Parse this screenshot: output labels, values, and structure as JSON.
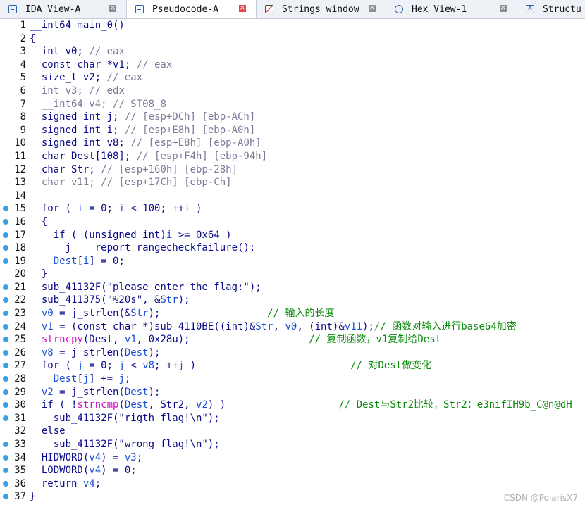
{
  "tabs": [
    {
      "label": "IDA View-A",
      "icon": "document-icon",
      "active": false
    },
    {
      "label": "Pseudocode-A",
      "icon": "document-icon",
      "active": true
    },
    {
      "label": "Strings window",
      "icon": "strings-icon",
      "active": false
    },
    {
      "label": "Hex View-1",
      "icon": "hex-icon",
      "active": false
    },
    {
      "label": "Structu",
      "icon": "structure-icon",
      "active": false
    }
  ],
  "tab_close_glyph": "×",
  "code_lines": [
    {
      "n": "1",
      "dot": false,
      "segs": [
        {
          "t": "__int64 main_0()",
          "c": "kw"
        }
      ]
    },
    {
      "n": "2",
      "dot": false,
      "segs": [
        {
          "t": "{",
          "c": "kw"
        }
      ]
    },
    {
      "n": "3",
      "dot": false,
      "segs": [
        {
          "t": "  int v0; ",
          "c": "kw"
        },
        {
          "t": "// eax",
          "c": "gry"
        }
      ]
    },
    {
      "n": "4",
      "dot": false,
      "segs": [
        {
          "t": "  const char *v1; ",
          "c": "kw"
        },
        {
          "t": "// eax",
          "c": "gry"
        }
      ]
    },
    {
      "n": "5",
      "dot": false,
      "segs": [
        {
          "t": "  size_t v2; ",
          "c": "kw"
        },
        {
          "t": "// eax",
          "c": "gry"
        }
      ]
    },
    {
      "n": "6",
      "dot": false,
      "segs": [
        {
          "t": "  int v3; ",
          "c": "gry"
        },
        {
          "t": "// edx",
          "c": "gry"
        }
      ]
    },
    {
      "n": "7",
      "dot": false,
      "segs": [
        {
          "t": "  __int64 v4; ",
          "c": "gry"
        },
        {
          "t": "// ST08_8",
          "c": "gry"
        }
      ]
    },
    {
      "n": "8",
      "dot": false,
      "segs": [
        {
          "t": "  signed int j; ",
          "c": "kw"
        },
        {
          "t": "// [esp+DCh] [ebp-ACh]",
          "c": "gry"
        }
      ]
    },
    {
      "n": "9",
      "dot": false,
      "segs": [
        {
          "t": "  signed int i; ",
          "c": "kw"
        },
        {
          "t": "// [esp+E8h] [ebp-A0h]",
          "c": "gry"
        }
      ]
    },
    {
      "n": "10",
      "dot": false,
      "segs": [
        {
          "t": "  signed int v8; ",
          "c": "kw"
        },
        {
          "t": "// [esp+E8h] [ebp-A0h]",
          "c": "gry"
        }
      ]
    },
    {
      "n": "11",
      "dot": false,
      "segs": [
        {
          "t": "  char Dest[108]; ",
          "c": "kw"
        },
        {
          "t": "// [esp+F4h] [ebp-94h]",
          "c": "gry"
        }
      ]
    },
    {
      "n": "12",
      "dot": false,
      "segs": [
        {
          "t": "  char Str; ",
          "c": "kw"
        },
        {
          "t": "// [esp+160h] [ebp-28h]",
          "c": "gry"
        }
      ]
    },
    {
      "n": "13",
      "dot": false,
      "segs": [
        {
          "t": "  char v11; ",
          "c": "gry"
        },
        {
          "t": "// [esp+17Ch] [ebp-Ch]",
          "c": "gry"
        }
      ]
    },
    {
      "n": "14",
      "dot": false,
      "segs": [
        {
          "t": "",
          "c": "kw"
        }
      ]
    },
    {
      "n": "15",
      "dot": true,
      "segs": [
        {
          "t": "  for ( ",
          "c": "kw"
        },
        {
          "t": "i",
          "c": "var"
        },
        {
          "t": " = 0; ",
          "c": "kw"
        },
        {
          "t": "i",
          "c": "var"
        },
        {
          "t": " < 100; ++",
          "c": "kw"
        },
        {
          "t": "i",
          "c": "var"
        },
        {
          "t": " )",
          "c": "kw"
        }
      ]
    },
    {
      "n": "16",
      "dot": true,
      "segs": [
        {
          "t": "  {",
          "c": "kw"
        }
      ]
    },
    {
      "n": "17",
      "dot": true,
      "segs": [
        {
          "t": "    if ( (unsigned int)",
          "c": "kw"
        },
        {
          "t": "i",
          "c": "var"
        },
        {
          "t": " >= 0x64 )",
          "c": "kw"
        }
      ]
    },
    {
      "n": "18",
      "dot": true,
      "segs": [
        {
          "t": "      j____report_rangecheckfailure();",
          "c": "kw"
        }
      ]
    },
    {
      "n": "19",
      "dot": true,
      "segs": [
        {
          "t": "    ",
          "c": "kw"
        },
        {
          "t": "Dest",
          "c": "var"
        },
        {
          "t": "[",
          "c": "kw"
        },
        {
          "t": "i",
          "c": "var"
        },
        {
          "t": "] = 0;",
          "c": "kw"
        }
      ]
    },
    {
      "n": "20",
      "dot": false,
      "segs": [
        {
          "t": "  }",
          "c": "kw"
        }
      ]
    },
    {
      "n": "21",
      "dot": true,
      "segs": [
        {
          "t": "  sub_41132F(\"please enter the flag:\");",
          "c": "kw"
        }
      ]
    },
    {
      "n": "22",
      "dot": true,
      "segs": [
        {
          "t": "  sub_411375(\"%20s\", &",
          "c": "kw"
        },
        {
          "t": "Str",
          "c": "var"
        },
        {
          "t": ");",
          "c": "kw"
        }
      ]
    },
    {
      "n": "23",
      "dot": true,
      "segs": [
        {
          "t": "  ",
          "c": "kw"
        },
        {
          "t": "v0",
          "c": "var"
        },
        {
          "t": " = j_strlen(&",
          "c": "kw"
        },
        {
          "t": "Str",
          "c": "var"
        },
        {
          "t": ");                  ",
          "c": "kw"
        },
        {
          "t": "// 输入的长度",
          "c": "cmt"
        }
      ]
    },
    {
      "n": "24",
      "dot": true,
      "segs": [
        {
          "t": "  ",
          "c": "kw"
        },
        {
          "t": "v1",
          "c": "var"
        },
        {
          "t": " = (const char *)sub_4110BE((int)&",
          "c": "kw"
        },
        {
          "t": "Str",
          "c": "var"
        },
        {
          "t": ", ",
          "c": "kw"
        },
        {
          "t": "v0",
          "c": "var"
        },
        {
          "t": ", (int)&",
          "c": "kw"
        },
        {
          "t": "v11",
          "c": "var"
        },
        {
          "t": ");",
          "c": "kw"
        },
        {
          "t": "// 函数对输入进行base64加密",
          "c": "cmt"
        }
      ]
    },
    {
      "n": "25",
      "dot": true,
      "segs": [
        {
          "t": "  ",
          "c": "kw"
        },
        {
          "t": "strncpy",
          "c": "fn"
        },
        {
          "t": "(Dest, ",
          "c": "kw"
        },
        {
          "t": "v1",
          "c": "var"
        },
        {
          "t": ", 0x28u);                    ",
          "c": "kw"
        },
        {
          "t": "// 复制函数，v1复制给Dest",
          "c": "cmt"
        }
      ]
    },
    {
      "n": "26",
      "dot": true,
      "segs": [
        {
          "t": "  ",
          "c": "kw"
        },
        {
          "t": "v8",
          "c": "var"
        },
        {
          "t": " = j_strlen(",
          "c": "kw"
        },
        {
          "t": "Dest",
          "c": "var"
        },
        {
          "t": ");",
          "c": "kw"
        }
      ]
    },
    {
      "n": "27",
      "dot": true,
      "segs": [
        {
          "t": "  for ( ",
          "c": "kw"
        },
        {
          "t": "j",
          "c": "var"
        },
        {
          "t": " = 0; ",
          "c": "kw"
        },
        {
          "t": "j",
          "c": "var"
        },
        {
          "t": " < ",
          "c": "kw"
        },
        {
          "t": "v8",
          "c": "var"
        },
        {
          "t": "; ++",
          "c": "kw"
        },
        {
          "t": "j",
          "c": "var"
        },
        {
          "t": " )                          ",
          "c": "kw"
        },
        {
          "t": "// 对Dest做变化",
          "c": "cmt"
        }
      ]
    },
    {
      "n": "28",
      "dot": true,
      "segs": [
        {
          "t": "    ",
          "c": "kw"
        },
        {
          "t": "Dest",
          "c": "var"
        },
        {
          "t": "[",
          "c": "kw"
        },
        {
          "t": "j",
          "c": "var"
        },
        {
          "t": "] += ",
          "c": "kw"
        },
        {
          "t": "j",
          "c": "var"
        },
        {
          "t": ";",
          "c": "kw"
        }
      ]
    },
    {
      "n": "29",
      "dot": true,
      "segs": [
        {
          "t": "  ",
          "c": "kw"
        },
        {
          "t": "v2",
          "c": "var"
        },
        {
          "t": " = j_strlen(",
          "c": "kw"
        },
        {
          "t": "Dest",
          "c": "var"
        },
        {
          "t": ");",
          "c": "kw"
        }
      ]
    },
    {
      "n": "30",
      "dot": true,
      "segs": [
        {
          "t": "  if ( !",
          "c": "kw"
        },
        {
          "t": "strncmp",
          "c": "fn"
        },
        {
          "t": "(",
          "c": "kw"
        },
        {
          "t": "Dest",
          "c": "var"
        },
        {
          "t": ", Str2, ",
          "c": "kw"
        },
        {
          "t": "v2",
          "c": "var"
        },
        {
          "t": ") )                   ",
          "c": "kw"
        },
        {
          "t": "// Dest与Str2比较，Str2：e3nifIH9b_C@n@dH",
          "c": "cmt"
        }
      ]
    },
    {
      "n": "31",
      "dot": true,
      "segs": [
        {
          "t": "    sub_41132F(\"rigth flag!\\n\");",
          "c": "kw"
        }
      ]
    },
    {
      "n": "32",
      "dot": false,
      "segs": [
        {
          "t": "  else",
          "c": "kw"
        }
      ]
    },
    {
      "n": "33",
      "dot": true,
      "segs": [
        {
          "t": "    sub_41132F(\"wrong flag!\\n\");",
          "c": "kw"
        }
      ]
    },
    {
      "n": "34",
      "dot": true,
      "segs": [
        {
          "t": "  HIDWORD(",
          "c": "kw"
        },
        {
          "t": "v4",
          "c": "var"
        },
        {
          "t": ") = ",
          "c": "kw"
        },
        {
          "t": "v3",
          "c": "var"
        },
        {
          "t": ";",
          "c": "kw"
        }
      ]
    },
    {
      "n": "35",
      "dot": true,
      "segs": [
        {
          "t": "  LODWORD(",
          "c": "kw"
        },
        {
          "t": "v4",
          "c": "var"
        },
        {
          "t": ") = 0;",
          "c": "kw"
        }
      ]
    },
    {
      "n": "36",
      "dot": true,
      "segs": [
        {
          "t": "  return ",
          "c": "kw"
        },
        {
          "t": "v4",
          "c": "var"
        },
        {
          "t": ";",
          "c": "kw"
        }
      ]
    },
    {
      "n": "37",
      "dot": true,
      "segs": [
        {
          "t": "}",
          "c": "kw"
        }
      ]
    }
  ],
  "watermark": "CSDN @PolarisX7",
  "colors": {
    "keyword": "#0a0a8a",
    "variable": "#1a4fd6",
    "function": "#d013c3",
    "comment": "#0a8a0a",
    "gray": "#7a7a9a",
    "breakpoint_dot": "#3b9fe6",
    "tab_close_active": "#e04545"
  }
}
